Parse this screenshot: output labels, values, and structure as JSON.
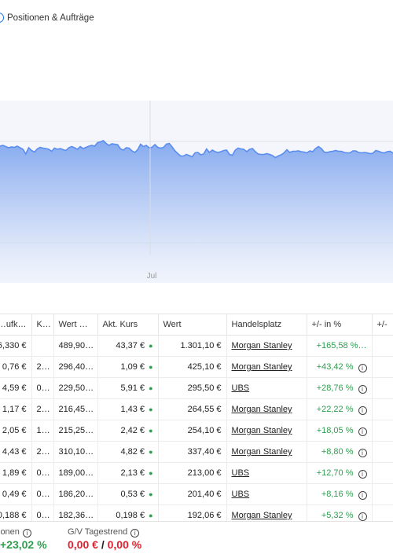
{
  "top": {
    "label": "Positionen & Aufträge"
  },
  "chart_data": {
    "type": "area",
    "x_tick_labels": [
      "Jul"
    ],
    "series": [
      {
        "values": [
          64,
          66,
          63,
          60,
          62,
          61,
          64,
          60,
          56,
          44,
          60,
          53,
          49,
          57,
          61,
          59,
          58,
          56,
          51,
          59,
          56,
          58,
          55,
          53,
          60,
          63,
          60,
          56,
          63,
          58,
          61,
          64,
          66,
          64,
          73,
          75,
          78,
          71,
          66,
          70,
          69,
          68,
          57,
          54,
          60,
          59,
          52,
          48,
          55,
          69,
          63,
          66,
          60,
          61,
          68,
          61,
          59,
          61,
          69,
          71,
          62,
          52,
          45,
          39,
          39,
          43,
          40,
          37,
          47,
          48,
          42,
          44,
          57,
          48,
          54,
          50,
          48,
          50,
          53,
          54,
          43,
          41,
          54,
          59,
          57,
          56,
          50,
          56,
          58,
          50,
          44,
          43,
          43,
          45,
          43,
          40,
          35,
          39,
          42,
          47,
          55,
          48,
          51,
          51,
          52,
          50,
          49,
          47,
          52,
          50,
          58,
          63,
          58,
          49,
          48,
          50,
          51,
          53,
          51,
          51,
          48,
          47,
          47,
          52,
          52,
          48,
          47,
          48,
          47,
          45,
          46,
          53,
          51,
          48,
          47,
          50,
          51,
          46
        ],
        "color": "#7fa6ee"
      }
    ],
    "grid": true
  },
  "table": {
    "headers": [
      "…ufk…",
      "K…",
      "Wert …",
      "Akt. Kurs",
      "Wert",
      "Handelsplatz",
      "+/- in %",
      "+/-"
    ],
    "rows": [
      {
        "c1": "6,330 €",
        "c2": "",
        "c3": "489,90…",
        "kurs": "43,37 €",
        "wert": "1.301,10 €",
        "platz": "Morgan Stanley",
        "pct": "+165,58 %…",
        "info": false
      },
      {
        "c1": "0,76 €",
        "c2": "2…",
        "c3": "296,40…",
        "kurs": "1,09 €",
        "wert": "425,10 €",
        "platz": "Morgan Stanley",
        "pct": "+43,42 %",
        "info": true
      },
      {
        "c1": "4,59 €",
        "c2": "0…",
        "c3": "229,50…",
        "kurs": "5,91 €",
        "wert": "295,50 €",
        "platz": "UBS",
        "pct": "+28,76 %",
        "info": true
      },
      {
        "c1": "1,17 €",
        "c2": "2…",
        "c3": "216,45…",
        "kurs": "1,43 €",
        "wert": "264,55 €",
        "platz": "Morgan Stanley",
        "pct": "+22,22 %",
        "info": true
      },
      {
        "c1": "2,05 €",
        "c2": "1…",
        "c3": "215,25…",
        "kurs": "2,42 €",
        "wert": "254,10 €",
        "platz": "Morgan Stanley",
        "pct": "+18,05 %",
        "info": true
      },
      {
        "c1": "4,43 €",
        "c2": "2…",
        "c3": "310,10…",
        "kurs": "4,82 €",
        "wert": "337,40 €",
        "platz": "Morgan Stanley",
        "pct": "+8,80 %",
        "info": true
      },
      {
        "c1": "1,89 €",
        "c2": "0…",
        "c3": "189,00…",
        "kurs": "2,13 €",
        "wert": "213,00 €",
        "platz": "UBS",
        "pct": "+12,70 %",
        "info": true
      },
      {
        "c1": "0,49 €",
        "c2": "0…",
        "c3": "186,20…",
        "kurs": "0,53 €",
        "wert": "201,40 €",
        "platz": "UBS",
        "pct": "+8,16 %",
        "info": true
      },
      {
        "c1": "0,188 €",
        "c2": "0…",
        "c3": "182,36…",
        "kurs": "0,198 €",
        "wert": "192,06 €",
        "platz": "Morgan Stanley",
        "pct": "+5,32 %",
        "info": true
      }
    ]
  },
  "footer": {
    "left_label": "ionen",
    "left_value": "+23,02 %",
    "right_label": "G/V Tagestrend",
    "right_value_eur": "0,00 €",
    "right_sep": " / ",
    "right_value_pct": "0,00 %",
    "colors": {
      "positive": "#2e9e4f",
      "neutral_red": "#e0202e"
    }
  }
}
